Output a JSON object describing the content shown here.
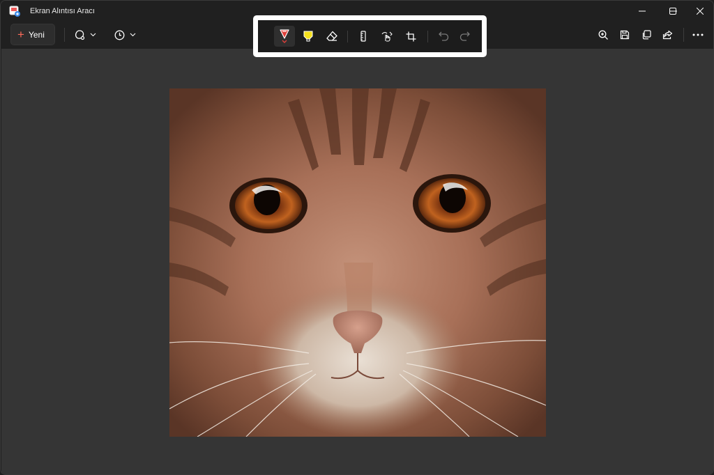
{
  "window": {
    "title": "Ekran Alıntısı Aracı",
    "controls": [
      "minimize-icon",
      "maximize-icon",
      "close-icon"
    ]
  },
  "toolbar": {
    "new_label": "Yeni",
    "new_icon": "plus-icon",
    "snip_mode_icon": "snip-shape-icon",
    "delay_icon": "clock-icon",
    "right_icons": [
      "zoom-in-icon",
      "save-icon",
      "copy-icon",
      "share-icon",
      "more-icon"
    ]
  },
  "tools": {
    "items": [
      "ballpoint-pen-icon",
      "highlighter-icon",
      "eraser-icon",
      "ruler-icon",
      "touch-writing-icon",
      "crop-icon",
      "undo-icon",
      "redo-icon"
    ],
    "active": "ballpoint-pen-icon",
    "pen_color": "#e0403a",
    "highlighter_color": "#f5e11c"
  },
  "canvas": {
    "image_subject": "close-up of an orange tabby cat's face with amber eyes"
  },
  "colors": {
    "background": "#202020",
    "canvas": "#353535",
    "accent": "#ff6b5a",
    "highlight_frame": "#ffffff"
  }
}
